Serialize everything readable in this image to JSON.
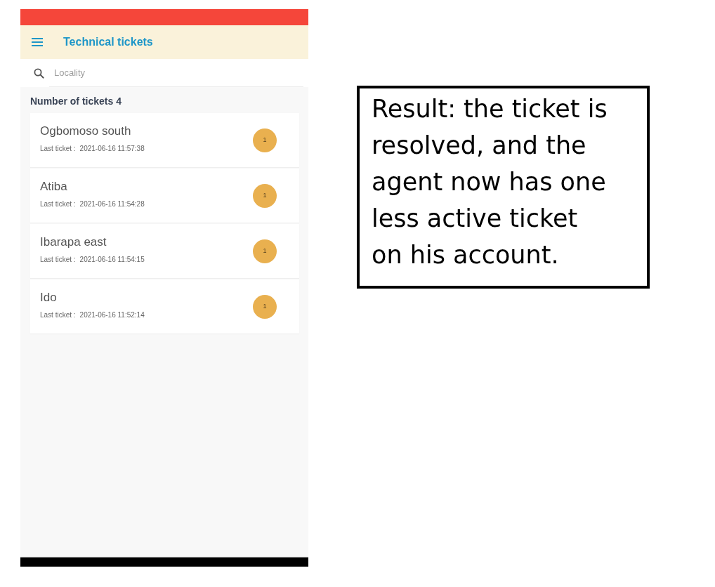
{
  "app_bar": {
    "title": "Technical tickets"
  },
  "search": {
    "placeholder": "Locality"
  },
  "summary": {
    "text": "Number of tickets 4"
  },
  "localities": [
    {
      "name": "Ogbomoso south",
      "last_ticket_label": "Last ticket :",
      "last_ticket": "2021-06-16 11:57:38",
      "count": "1"
    },
    {
      "name": "Atiba",
      "last_ticket_label": "Last ticket :",
      "last_ticket": "2021-06-16 11:54:28",
      "count": "1"
    },
    {
      "name": "Ibarapa east",
      "last_ticket_label": "Last ticket :",
      "last_ticket": "2021-06-16 11:54:15",
      "count": "1"
    },
    {
      "name": "Ido",
      "last_ticket_label": "Last ticket :",
      "last_ticket": "2021-06-16 11:52:14",
      "count": "1"
    }
  ],
  "note": {
    "lines": [
      "Result: the ticket is",
      "resolved, and the",
      "agent now has one",
      "less active ticket",
      "on his account."
    ]
  }
}
